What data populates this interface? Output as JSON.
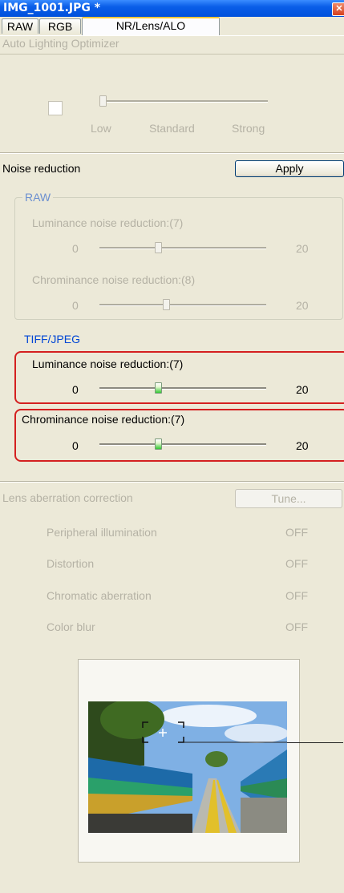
{
  "window": {
    "title": "IMG_1001.JPG *",
    "close_glyph": "✕"
  },
  "tabs": [
    {
      "label": "RAW"
    },
    {
      "label": "RGB"
    },
    {
      "label": "NR/Lens/ALO"
    }
  ],
  "alo": {
    "header": "Auto Lighting Optimizer",
    "levels": [
      "Low",
      "Standard",
      "Strong"
    ]
  },
  "noise": {
    "header": "Noise reduction",
    "apply_label": "Apply",
    "raw_group": "RAW",
    "raw_luminance_label": "Luminance noise reduction:(7)",
    "raw_chrominance_label": "Chrominance noise reduction:(8)",
    "tiff_group": "TIFF/JPEG",
    "tiff_luminance_label": "Luminance noise reduction:(7)",
    "tiff_chrominance_label": "Chrominance noise reduction:(7)",
    "min": "0",
    "max": "20",
    "raw_luminance_value": 7,
    "raw_chrominance_value": 8,
    "tiff_luminance_value": 7,
    "tiff_chrominance_value": 7
  },
  "lens": {
    "header": "Lens aberration correction",
    "tune_label": "Tune...",
    "items": [
      {
        "label": "Peripheral illumination",
        "value": "OFF"
      },
      {
        "label": "Distortion",
        "value": "OFF"
      },
      {
        "label": "Chromatic aberration",
        "value": "OFF"
      },
      {
        "label": "Color blur",
        "value": "OFF"
      }
    ]
  },
  "colors": {
    "accent_blue": "#0050dc",
    "group_label_blue": "#0046d5",
    "highlight_red": "#d42020",
    "slider_thumb_green": "#32c832"
  }
}
